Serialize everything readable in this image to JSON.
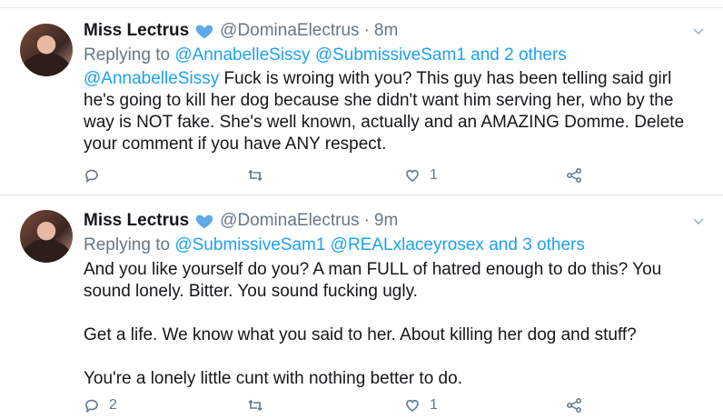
{
  "tweets": [
    {
      "author_name": "Miss Lectrus",
      "handle": "@DominaElectrus",
      "separator": "·",
      "time": "8m",
      "replying_prefix": "Replying to",
      "replying_users": "@AnnabelleSissy @SubmissiveSam1",
      "replying_connector": "and",
      "replying_others": "2 others",
      "mention": "@AnnabelleSissy",
      "text": " Fuck is wroing with you? This guy has been telling said girl he's going to kill her dog because she didn't want him serving her, who by the way is NOT fake. She's well known, actually and an AMAZING Domme. Delete your comment if you have ANY respect.",
      "reply_count": "",
      "retweet_count": "",
      "like_count": "1"
    },
    {
      "author_name": "Miss Lectrus",
      "handle": "@DominaElectrus",
      "separator": "·",
      "time": "9m",
      "replying_prefix": "Replying to",
      "replying_users": "@SubmissiveSam1 @REALxlaceyrosex",
      "replying_connector": "and",
      "replying_others": "3 others",
      "text": "And you like yourself do you? A man FULL of hatred enough to do this? You sound lonely. Bitter. You sound fucking ugly.\n\nGet a life. We know what you said to her. About killing her dog and stuff?\n\nYou're a lonely little cunt with nothing better to do.",
      "reply_count": "2",
      "retweet_count": "",
      "like_count": "1"
    }
  ],
  "icons": {
    "verified": "verified-badge-icon",
    "menu": "chevron-down-icon",
    "reply": "reply-icon",
    "retweet": "retweet-icon",
    "like": "heart-icon",
    "share": "share-icon"
  },
  "colors": {
    "link": "#1da1f2",
    "muted": "#657786",
    "text": "#14171a",
    "divider": "#e1e8ed"
  }
}
